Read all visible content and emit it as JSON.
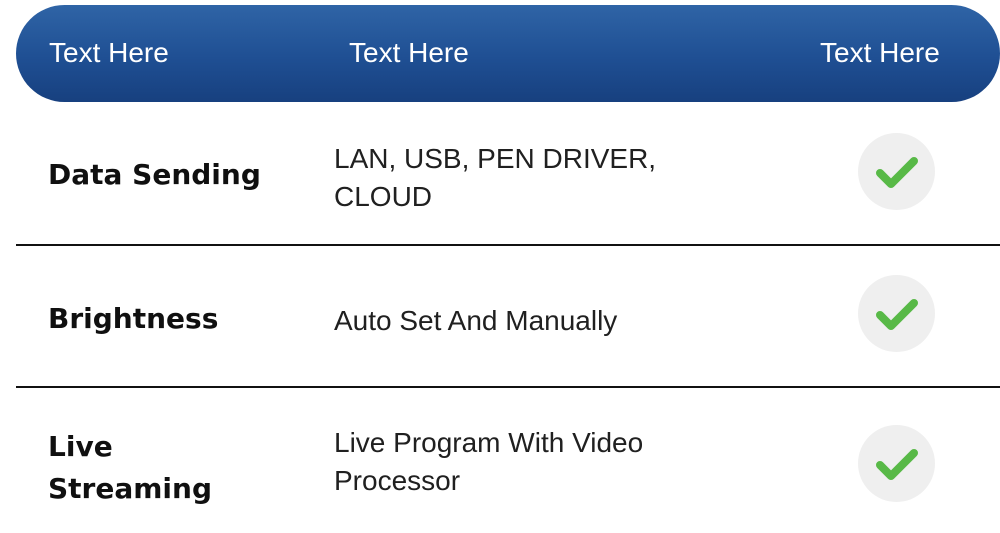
{
  "header": {
    "col_1": "Text Here",
    "col_2": "Text Here",
    "col_3": "Text Here"
  },
  "rows": [
    {
      "feature": [
        "Data Sending"
      ],
      "detail": [
        "LAN, USB, PEN DRIVER,",
        "CLOUD"
      ],
      "status_icon": "checkmark-icon"
    },
    {
      "feature": [
        "Brightness"
      ],
      "detail": [
        "Auto Set And Manually"
      ],
      "status_icon": "checkmark-icon"
    },
    {
      "feature": [
        "Live",
        "Streaming"
      ],
      "detail": [
        "Live Program With Video",
        "Processor"
      ],
      "status_icon": "checkmark-icon"
    }
  ],
  "colors": {
    "header_start": "#2f64a6",
    "header_end": "#17407f",
    "check_green": "#58b947",
    "check_circle": "#efefef"
  }
}
